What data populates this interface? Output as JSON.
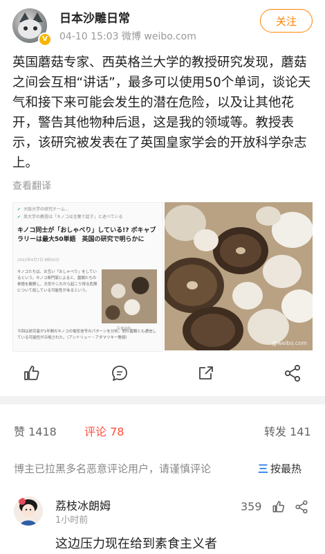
{
  "post": {
    "username": "日本沙雕日常",
    "meta": "04-10 15:03  微博 weibo.com",
    "follow_label": "关注",
    "text": "英国蘑菇专家、西英格兰大学的教授研究发现，蘑菇之间会互相“讲话”，最多可以使用50个单词，谈论天气和接下来可能会发生的潜在危险，以及让其他花开，警告其他物种后退，这是我的领域等。教授表示，该研究被发表在了英国皇家学会的开放科学杂志上。",
    "translate_label": "查看翻译"
  },
  "article_image": {
    "list_items": [
      "大阪大学の研究チーム...",
      "英大学の教授は「キノコは言葉で話す」と述べている"
    ],
    "headline": "キノコ同士が「おしゃべり」している!? ボキャブラリーは最大50単語　英国の研究で明らかに",
    "date": "2022年4月7日 8時30分",
    "body": "キノコたちは、お互い「おしゃべり」をしているという。キノコ専門家によると、菌類たちの単語を観察し、天気やこれから起こり得る危険について話している可能性があるという。",
    "caption": "写真提供",
    "body2": "今回は研究者が1年間のキノコの電気信号のパターンを分析。他の菌類とも通信している可能性が示唆された。（アンドリュー・アダマツキー教授）"
  },
  "photo": {
    "watermark": "@weibo.com"
  },
  "actions": {
    "icons": [
      "like-icon",
      "comment-icon",
      "share-icon",
      "more-share-icon"
    ]
  },
  "stats": {
    "likes_label": "赞",
    "likes_count": "1418",
    "comments_label": "评论",
    "comments_count": "78",
    "reposts_label": "转发",
    "reposts_count": "141"
  },
  "comments_header": {
    "notice": "博主已拉黑多名恶意评论用户，请谨慎评论",
    "sort_icon": "三",
    "sort_label": "按最热"
  },
  "comment": {
    "name": "荔枝冰朗姆",
    "time": "1小时前",
    "likes": "359",
    "text": "这边压力现在给到素食主义者"
  },
  "colors": {
    "accent": "#ff8200",
    "comments_active": "#ff4c3c",
    "sort_blue": "#1a73e8",
    "verified": "#f7b500"
  }
}
